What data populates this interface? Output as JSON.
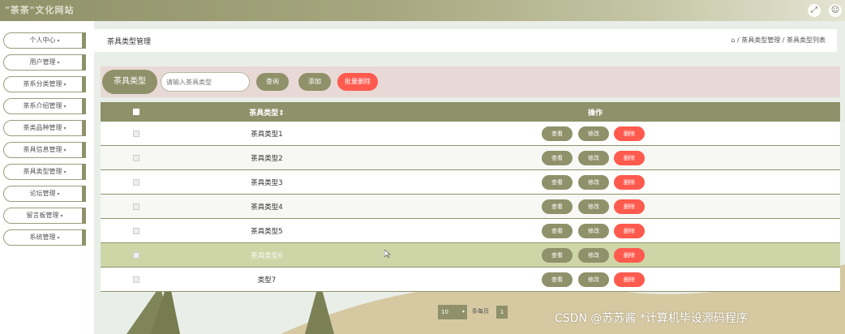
{
  "app": {
    "title": "\"茶茶\"文化网站"
  },
  "top_icons": [
    {
      "name": "fullscreen-icon",
      "glyph": "⤢"
    },
    {
      "name": "user-icon",
      "glyph": "☺"
    }
  ],
  "sidebar": {
    "items": [
      {
        "label": "个人中心"
      },
      {
        "label": "用户管理"
      },
      {
        "label": "茶系分类管理"
      },
      {
        "label": "茶系介绍管理"
      },
      {
        "label": "茶类品种管理"
      },
      {
        "label": "茶具信息管理"
      },
      {
        "label": "茶具类型管理"
      },
      {
        "label": "论坛管理"
      },
      {
        "label": "留言板管理"
      },
      {
        "label": "系统管理"
      }
    ],
    "arrow": "▾"
  },
  "breadcrumb": {
    "page_title": "茶具类型管理",
    "home_icon": "⌂",
    "trail": "/ 茶具类型管理 / 茶具类型列表"
  },
  "toolbar": {
    "label": "茶具类型",
    "search_placeholder": "请输入茶具类型",
    "query_label": "查询",
    "add_label": "添加",
    "batch_delete_label": "批量删除"
  },
  "table": {
    "header": {
      "name": "茶具类型⇕",
      "ops": "操作"
    },
    "rows": [
      {
        "name": "茶具类型1"
      },
      {
        "name": "茶具类型2"
      },
      {
        "name": "茶具类型3"
      },
      {
        "name": "茶具类型4"
      },
      {
        "name": "茶具类型5"
      },
      {
        "name": "茶具类型6"
      },
      {
        "name": "类型7"
      }
    ],
    "actions": {
      "view": "查看",
      "edit": "修改",
      "delete": "删除"
    }
  },
  "pagination": {
    "page_size": "10",
    "per_page_label": "条每页",
    "current_page": "1"
  },
  "watermark": "CSDN @苏苏酱  *计算机毕设源码程序",
  "colors": {
    "primary": "#8f916a",
    "danger": "#ff5a4e",
    "highlight_row": "#ced6a8",
    "toolbar_bg": "#e8d9d6"
  }
}
